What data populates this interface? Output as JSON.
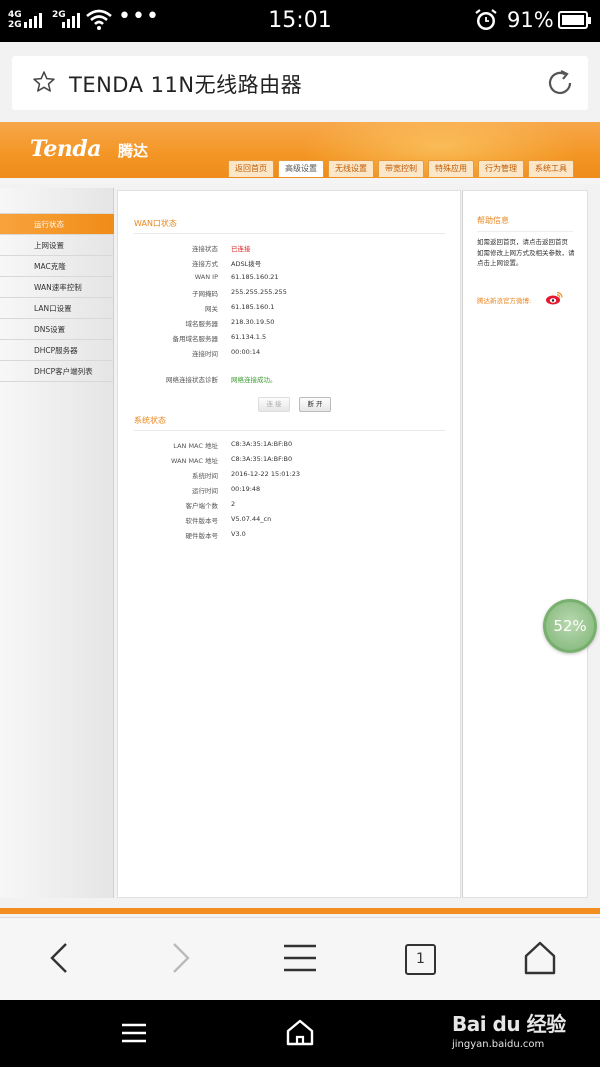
{
  "status_bar": {
    "signal_top": "4G",
    "signal_bottom": "2G",
    "signal2_top": "2G",
    "dots": "•••",
    "time": "15:01",
    "battery": "91%",
    "icons": [
      "signal-icon",
      "wifi-icon",
      "alarm-icon",
      "battery-icon"
    ]
  },
  "browser": {
    "title": "TENDA 11N无线路由器",
    "tab_count": "1"
  },
  "router": {
    "logo": "Tenda",
    "logo_cn": "腾达",
    "nav_tabs": [
      {
        "label": "返回首页"
      },
      {
        "label": "高级设置"
      },
      {
        "label": "无线设置"
      },
      {
        "label": "带宽控制"
      },
      {
        "label": "特殊应用"
      },
      {
        "label": "行为管理"
      },
      {
        "label": "系统工具"
      }
    ],
    "sidebar": [
      {
        "label": "运行状态"
      },
      {
        "label": "上网设置"
      },
      {
        "label": "MAC克隆"
      },
      {
        "label": "WAN速率控制"
      },
      {
        "label": "LAN口设置"
      },
      {
        "label": "DNS设置"
      },
      {
        "label": "DHCP服务器"
      },
      {
        "label": "DHCP客户端列表"
      }
    ],
    "wan": {
      "title": "WAN口状态",
      "rows": [
        {
          "k": "连接状态",
          "v": "已连接"
        },
        {
          "k": "连接方式",
          "v": "ADSL拨号"
        },
        {
          "k": "WAN IP",
          "v": "61.185.160.21"
        },
        {
          "k": "子网掩码",
          "v": "255.255.255.255"
        },
        {
          "k": "网关",
          "v": "61.185.160.1"
        },
        {
          "k": "域名服务器",
          "v": "218.30.19.50"
        },
        {
          "k": "备用域名服务器",
          "v": "61.134.1.5"
        },
        {
          "k": "连接时间",
          "v": "00:00:14"
        }
      ],
      "diag_label": "网络连接状态诊断",
      "diag_value": "网络连接成功。",
      "connect_btn": "连 接",
      "disconnect_btn": "断 开"
    },
    "system": {
      "title": "系统状态",
      "rows": [
        {
          "k": "LAN MAC 地址",
          "v": "C8:3A:35:1A:BF:B0"
        },
        {
          "k": "WAN MAC 地址",
          "v": "C8:3A:35:1A:BF:B0"
        },
        {
          "k": "系统时间",
          "v": "2016-12-22 15:01:23"
        },
        {
          "k": "运行时间",
          "v": "00:19:48"
        },
        {
          "k": "客户端个数",
          "v": "2"
        },
        {
          "k": "软件版本号",
          "v": "V5.07.44_cn"
        },
        {
          "k": "硬件版本号",
          "v": "V3.0"
        }
      ]
    },
    "help": {
      "title": "帮助信息",
      "text": "如需返回首页，请点击返回首页\n如需修改上网方式及相关参数，请点击上网设置。",
      "weibo": "腾达新浪官方微博:"
    }
  },
  "bubble": "52%",
  "watermark": {
    "logo": "Bai du 经验",
    "url": "jingyan.baidu.com"
  }
}
